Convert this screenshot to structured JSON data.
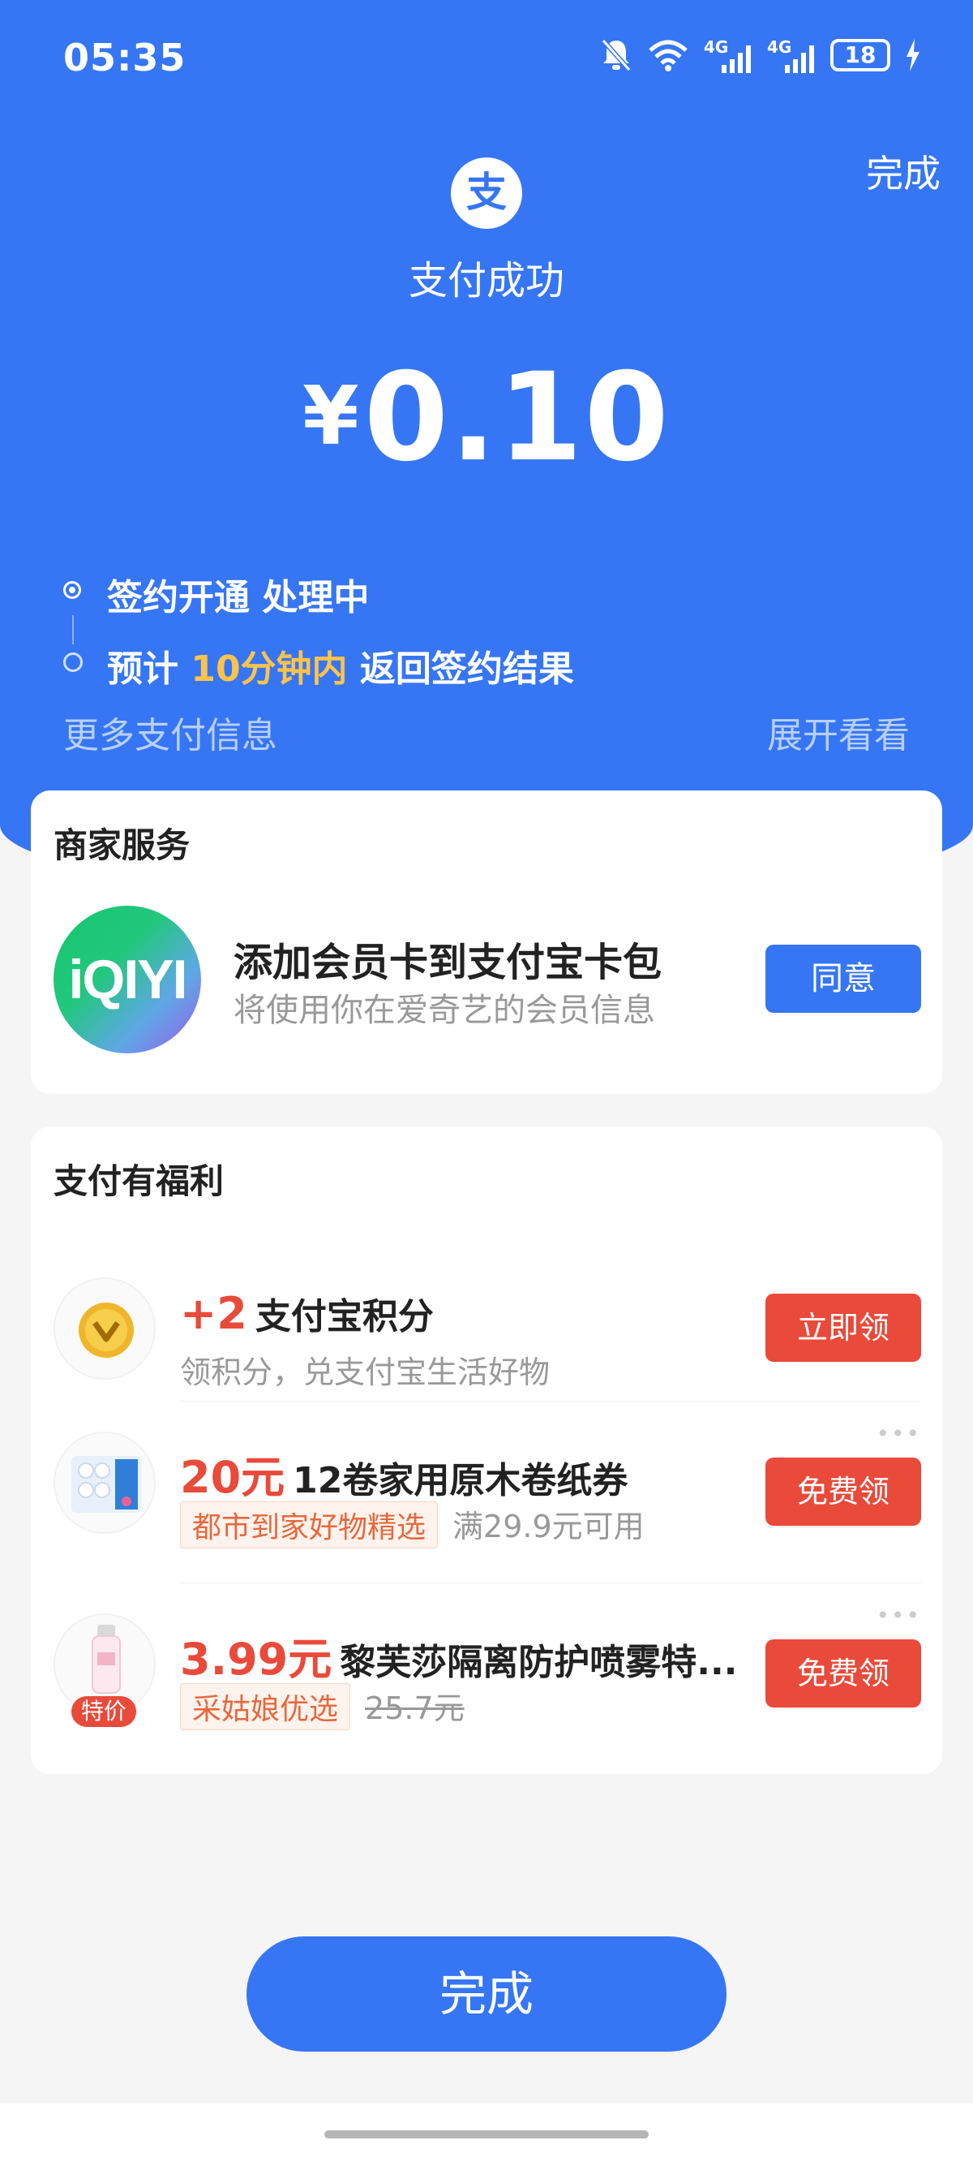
{
  "status": {
    "time": "05:35",
    "network1": "4G",
    "network2": "4G",
    "battery": "18"
  },
  "header": {
    "done_label": "完成",
    "title": "支付成功",
    "currency": "¥",
    "amount": "0.10"
  },
  "progress": {
    "step1": "签约开通 处理中",
    "step2_prefix": "预计 ",
    "step2_highlight": "10分钟内",
    "step2_suffix": " 返回签约结果"
  },
  "more_info": {
    "label": "更多支付信息",
    "expand": "展开看看"
  },
  "merchant": {
    "section_title": "商家服务",
    "logo_text": "iQIYI",
    "title": "添加会员卡到支付宝卡包",
    "subtitle": "将使用你在爱奇艺的会员信息",
    "button": "同意"
  },
  "benefits": {
    "section_title": "支付有福利",
    "items": [
      {
        "highlight": "+2",
        "title": "支付宝积分",
        "subtitle": "领积分，兑支付宝生活好物",
        "button": "立即领"
      },
      {
        "highlight": "20元",
        "title": "12卷家用原木卷纸券",
        "tag": "都市到家好物精选",
        "note": "满29.9元可用",
        "button": "免费领"
      },
      {
        "highlight": "3.99元",
        "title": "黎芙莎隔离防护喷雾特...",
        "tag": "采姑娘优选",
        "original_price": "25.7元",
        "badge": "特价",
        "button": "免费领"
      }
    ]
  },
  "footer": {
    "done_button": "完成"
  },
  "colors": {
    "brand_blue": "#3676f5",
    "accent_red": "#e94a3a",
    "highlight_yellow": "#ffc34a"
  }
}
